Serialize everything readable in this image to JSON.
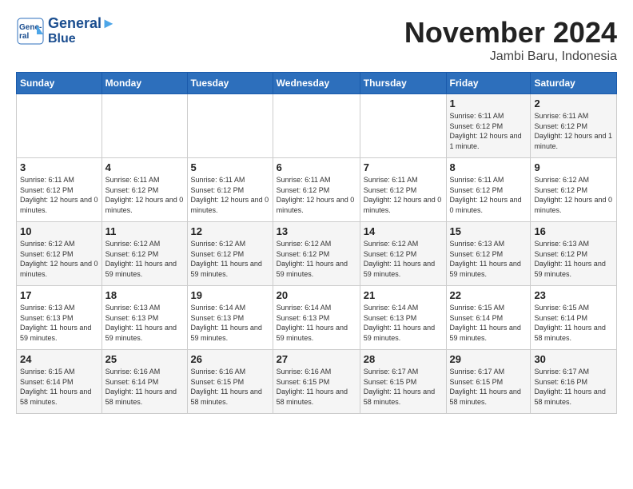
{
  "header": {
    "logo_line1": "General",
    "logo_line2": "Blue",
    "month": "November 2024",
    "location": "Jambi Baru, Indonesia"
  },
  "days_of_week": [
    "Sunday",
    "Monday",
    "Tuesday",
    "Wednesday",
    "Thursday",
    "Friday",
    "Saturday"
  ],
  "weeks": [
    [
      {
        "day": "",
        "info": ""
      },
      {
        "day": "",
        "info": ""
      },
      {
        "day": "",
        "info": ""
      },
      {
        "day": "",
        "info": ""
      },
      {
        "day": "",
        "info": ""
      },
      {
        "day": "1",
        "info": "Sunrise: 6:11 AM\nSunset: 6:12 PM\nDaylight: 12 hours and 1 minute."
      },
      {
        "day": "2",
        "info": "Sunrise: 6:11 AM\nSunset: 6:12 PM\nDaylight: 12 hours and 1 minute."
      }
    ],
    [
      {
        "day": "3",
        "info": "Sunrise: 6:11 AM\nSunset: 6:12 PM\nDaylight: 12 hours and 0 minutes."
      },
      {
        "day": "4",
        "info": "Sunrise: 6:11 AM\nSunset: 6:12 PM\nDaylight: 12 hours and 0 minutes."
      },
      {
        "day": "5",
        "info": "Sunrise: 6:11 AM\nSunset: 6:12 PM\nDaylight: 12 hours and 0 minutes."
      },
      {
        "day": "6",
        "info": "Sunrise: 6:11 AM\nSunset: 6:12 PM\nDaylight: 12 hours and 0 minutes."
      },
      {
        "day": "7",
        "info": "Sunrise: 6:11 AM\nSunset: 6:12 PM\nDaylight: 12 hours and 0 minutes."
      },
      {
        "day": "8",
        "info": "Sunrise: 6:11 AM\nSunset: 6:12 PM\nDaylight: 12 hours and 0 minutes."
      },
      {
        "day": "9",
        "info": "Sunrise: 6:12 AM\nSunset: 6:12 PM\nDaylight: 12 hours and 0 minutes."
      }
    ],
    [
      {
        "day": "10",
        "info": "Sunrise: 6:12 AM\nSunset: 6:12 PM\nDaylight: 12 hours and 0 minutes."
      },
      {
        "day": "11",
        "info": "Sunrise: 6:12 AM\nSunset: 6:12 PM\nDaylight: 11 hours and 59 minutes."
      },
      {
        "day": "12",
        "info": "Sunrise: 6:12 AM\nSunset: 6:12 PM\nDaylight: 11 hours and 59 minutes."
      },
      {
        "day": "13",
        "info": "Sunrise: 6:12 AM\nSunset: 6:12 PM\nDaylight: 11 hours and 59 minutes."
      },
      {
        "day": "14",
        "info": "Sunrise: 6:12 AM\nSunset: 6:12 PM\nDaylight: 11 hours and 59 minutes."
      },
      {
        "day": "15",
        "info": "Sunrise: 6:13 AM\nSunset: 6:12 PM\nDaylight: 11 hours and 59 minutes."
      },
      {
        "day": "16",
        "info": "Sunrise: 6:13 AM\nSunset: 6:12 PM\nDaylight: 11 hours and 59 minutes."
      }
    ],
    [
      {
        "day": "17",
        "info": "Sunrise: 6:13 AM\nSunset: 6:13 PM\nDaylight: 11 hours and 59 minutes."
      },
      {
        "day": "18",
        "info": "Sunrise: 6:13 AM\nSunset: 6:13 PM\nDaylight: 11 hours and 59 minutes."
      },
      {
        "day": "19",
        "info": "Sunrise: 6:14 AM\nSunset: 6:13 PM\nDaylight: 11 hours and 59 minutes."
      },
      {
        "day": "20",
        "info": "Sunrise: 6:14 AM\nSunset: 6:13 PM\nDaylight: 11 hours and 59 minutes."
      },
      {
        "day": "21",
        "info": "Sunrise: 6:14 AM\nSunset: 6:13 PM\nDaylight: 11 hours and 59 minutes."
      },
      {
        "day": "22",
        "info": "Sunrise: 6:15 AM\nSunset: 6:14 PM\nDaylight: 11 hours and 59 minutes."
      },
      {
        "day": "23",
        "info": "Sunrise: 6:15 AM\nSunset: 6:14 PM\nDaylight: 11 hours and 58 minutes."
      }
    ],
    [
      {
        "day": "24",
        "info": "Sunrise: 6:15 AM\nSunset: 6:14 PM\nDaylight: 11 hours and 58 minutes."
      },
      {
        "day": "25",
        "info": "Sunrise: 6:16 AM\nSunset: 6:14 PM\nDaylight: 11 hours and 58 minutes."
      },
      {
        "day": "26",
        "info": "Sunrise: 6:16 AM\nSunset: 6:15 PM\nDaylight: 11 hours and 58 minutes."
      },
      {
        "day": "27",
        "info": "Sunrise: 6:16 AM\nSunset: 6:15 PM\nDaylight: 11 hours and 58 minutes."
      },
      {
        "day": "28",
        "info": "Sunrise: 6:17 AM\nSunset: 6:15 PM\nDaylight: 11 hours and 58 minutes."
      },
      {
        "day": "29",
        "info": "Sunrise: 6:17 AM\nSunset: 6:15 PM\nDaylight: 11 hours and 58 minutes."
      },
      {
        "day": "30",
        "info": "Sunrise: 6:17 AM\nSunset: 6:16 PM\nDaylight: 11 hours and 58 minutes."
      }
    ]
  ]
}
